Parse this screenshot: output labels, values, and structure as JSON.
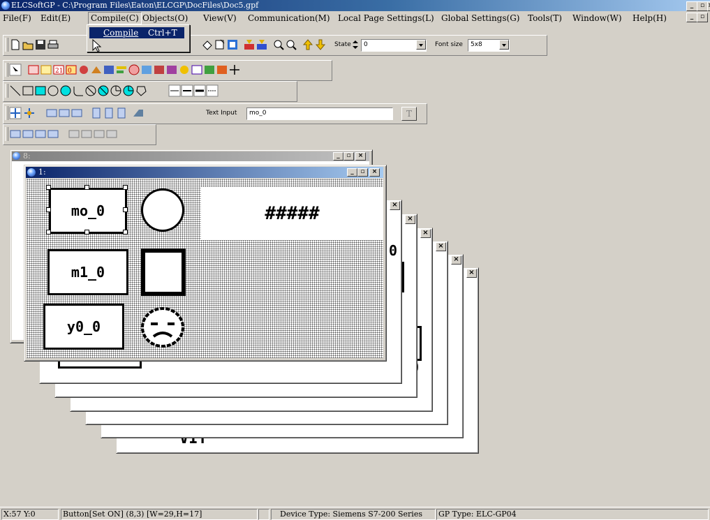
{
  "window": {
    "title": "ELCSoftGP - C:\\Program Files\\Eaton\\ELCGP\\DocFiles\\Doc5.gpf"
  },
  "menu": [
    "File(F)",
    "Edit(E)",
    "Compile(C)",
    "Objects(O)",
    "View(V)",
    "Communication(M)",
    "Local Page Settings(L)",
    "Global Settings(G)",
    "Tools(T)",
    "Window(W)",
    "Help(H)"
  ],
  "compile_menu": {
    "item_label": "Compile",
    "item_shortcut": "Ctrl+T"
  },
  "toolbar": {
    "state_label": "State",
    "state_value": "0",
    "font_size_label": "Font size",
    "font_size_value": "5x8",
    "text_input_label": "Text Input",
    "text_input_value": "mo_0",
    "text_button": "T"
  },
  "mdi": {
    "back_window_title": "8:",
    "front_window_title": "1:",
    "objects": {
      "button1": "mo_0",
      "button2": "m1_0",
      "button3": "y0_0",
      "numeric_display": "#####"
    },
    "peek_texts": {
      "bracket_b": "0",
      "bottom": "VIT"
    }
  },
  "status": {
    "coords": "X:57 Y:0",
    "object_info": "Button[Set ON] (8,3) [W=29,H=17]",
    "device_type": "Device Type: Siemens S7-200 Series",
    "gp_type": "GP Type: ELC-GP04"
  },
  "colors": {
    "title_start": "#0a246a",
    "title_end": "#a6caf0",
    "face": "#d4d0c8",
    "highlight": "#0a246a"
  }
}
